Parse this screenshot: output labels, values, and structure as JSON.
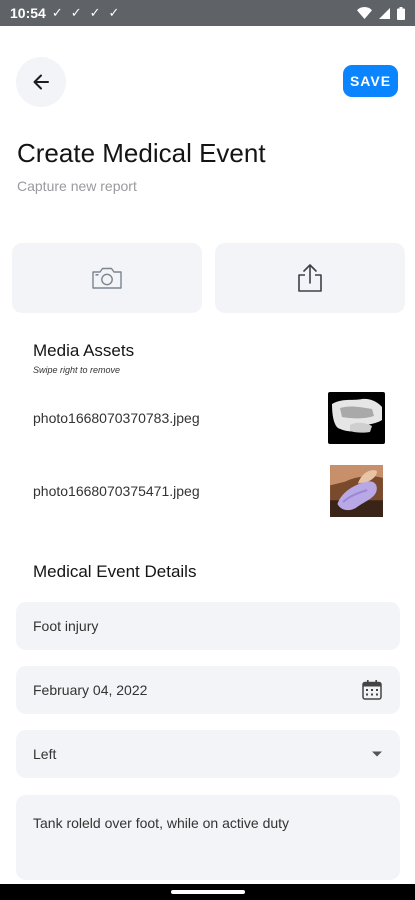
{
  "status_bar": {
    "time": "10:54",
    "checks": [
      "✓",
      "✓",
      "✓",
      "✓"
    ]
  },
  "header": {
    "back_icon": "arrow-left-icon",
    "save_label": "SAVE",
    "title": "Create Medical Event",
    "subtitle": "Capture new report"
  },
  "actions": [
    {
      "icon": "camera-icon"
    },
    {
      "icon": "share-upload-icon"
    }
  ],
  "media": {
    "title": "Media Assets",
    "hint": "Swipe right to remove",
    "items": [
      {
        "filename": "photo1668070370783.jpeg",
        "thumb": "x-ray-image"
      },
      {
        "filename": "photo1668070375471.jpeg",
        "thumb": "foot-photo-image"
      }
    ]
  },
  "details": {
    "title": "Medical Event Details",
    "event_name": "Foot injury",
    "date": "February 04, 2022",
    "side": "Left",
    "notes": "Tank roleld over foot, while on active duty"
  },
  "colors": {
    "accent": "#0a84ff",
    "field_bg": "#f3f4f7",
    "status_bar": "#5f6368"
  }
}
